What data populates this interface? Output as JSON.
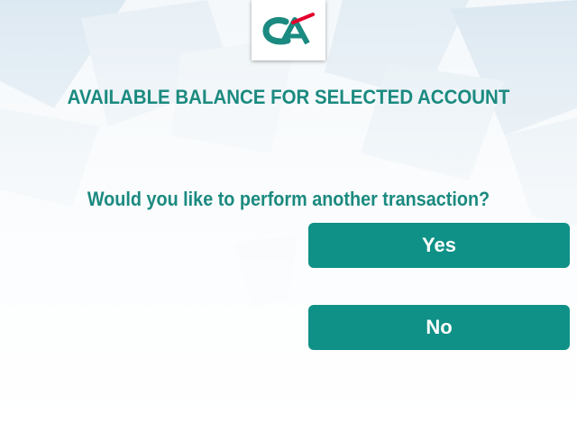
{
  "logo": {
    "icon": "credit-agricole-logo",
    "colors": {
      "green": "#1b8a80",
      "red": "#e4002b"
    }
  },
  "screen": {
    "heading": "AVAILABLE BALANCE FOR SELECTED ACCOUNT",
    "question": "Would you like to perform another transaction?"
  },
  "buttons": {
    "yes_label": "Yes",
    "no_label": "No"
  },
  "theme": {
    "accent": "#1b8a80",
    "button_bg": "#0f9187",
    "button_text": "#ffffff"
  }
}
